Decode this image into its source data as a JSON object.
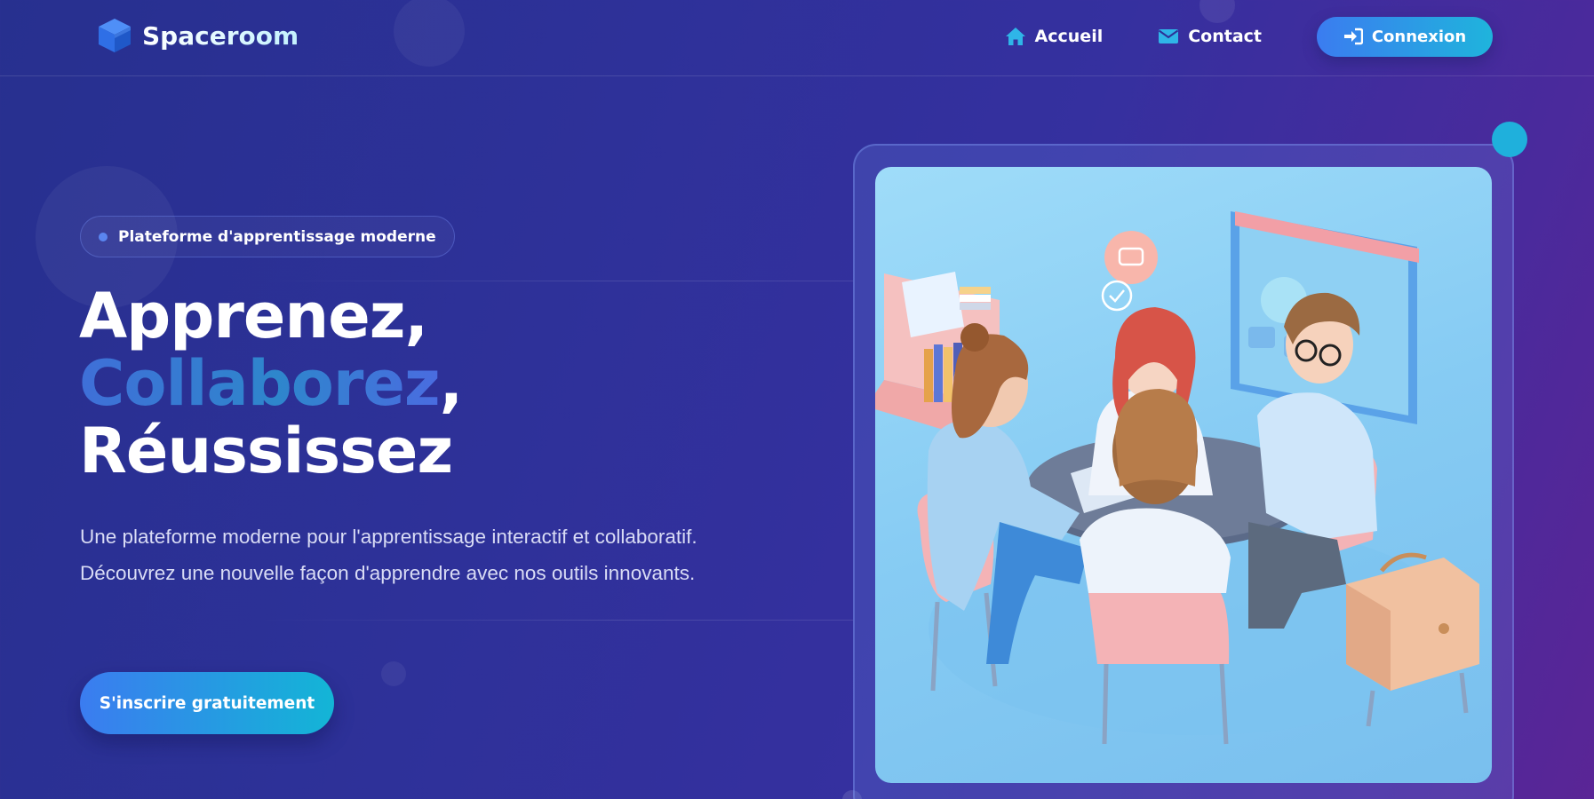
{
  "brand": {
    "name": "Spaceroom",
    "icon": "cube-icon"
  },
  "nav": {
    "items": [
      {
        "label": "Accueil",
        "icon": "home-icon"
      },
      {
        "label": "Contact",
        "icon": "envelope-icon"
      }
    ],
    "login": {
      "label": "Connexion",
      "icon": "sign-in-icon"
    }
  },
  "hero": {
    "badge": "Plateforme d'apprentissage moderne",
    "headline": {
      "line1": "Apprenez,",
      "line2_highlight": "Collaborez",
      "line2_suffix": ",",
      "line3": "Réussissez"
    },
    "subtitle": "Une plateforme moderne pour l'apprentissage interactif et collaboratif. Découvrez une nouvelle façon d'apprendre avec nos outils innovants.",
    "cta": "S'inscrire gratuitement"
  },
  "colors": {
    "background_start": "#27308f",
    "background_end": "#5a2596",
    "accent_blue": "#3b7cf0",
    "accent_cyan": "#1fb4dc",
    "illustration_bg": "#8ecff5"
  }
}
